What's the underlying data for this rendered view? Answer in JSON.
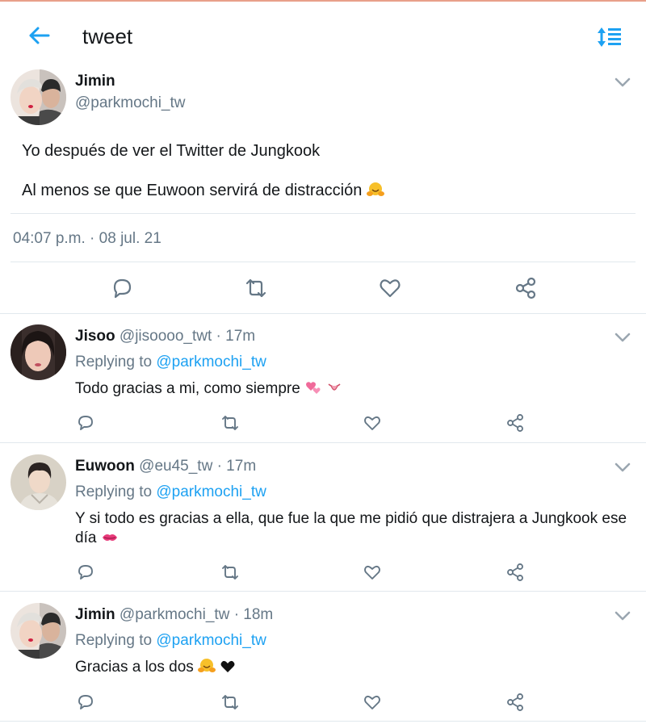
{
  "header": {
    "title": "tweet"
  },
  "main_tweet": {
    "name": "Jimin",
    "handle": "@parkmochi_tw",
    "line1": "Yo después de ver el Twitter de Jungkook",
    "line2": "Al menos se que Euwoon servirá de distracción",
    "line2_emoji": "hugging-face",
    "timestamp": "04:07 p.m. · 08 jul. 21"
  },
  "replies": [
    {
      "name": "Jisoo",
      "handle": "@jisoooo_twt",
      "time": "· 17m",
      "replying_prefix": "Replying to",
      "replying_handle": "@parkmochi_tw",
      "text": "Todo gracias a mi, como siempre",
      "emojis": [
        "revolving-hearts",
        "tongue-face"
      ]
    },
    {
      "name": "Euwoon",
      "handle": "@eu45_tw",
      "time": "· 17m",
      "replying_prefix": "Replying to",
      "replying_handle": "@parkmochi_tw",
      "text_line1": "Y si todo es gracias a ella, que fue la que me pidió que distrajera a Jungkook ese",
      "text_line2": "día",
      "emojis": [
        "kiss-mark"
      ]
    },
    {
      "name": "Jimin",
      "handle": "@parkmochi_tw",
      "time": "· 18m",
      "replying_prefix": "Replying to",
      "replying_handle": "@parkmochi_tw",
      "text": "Gracias a los dos",
      "emojis": [
        "hugging-face",
        "black-heart"
      ]
    }
  ],
  "colors": {
    "accent": "#1da1f2",
    "muted": "#657786",
    "divider": "#e1e8ed",
    "icon": "#657786"
  }
}
